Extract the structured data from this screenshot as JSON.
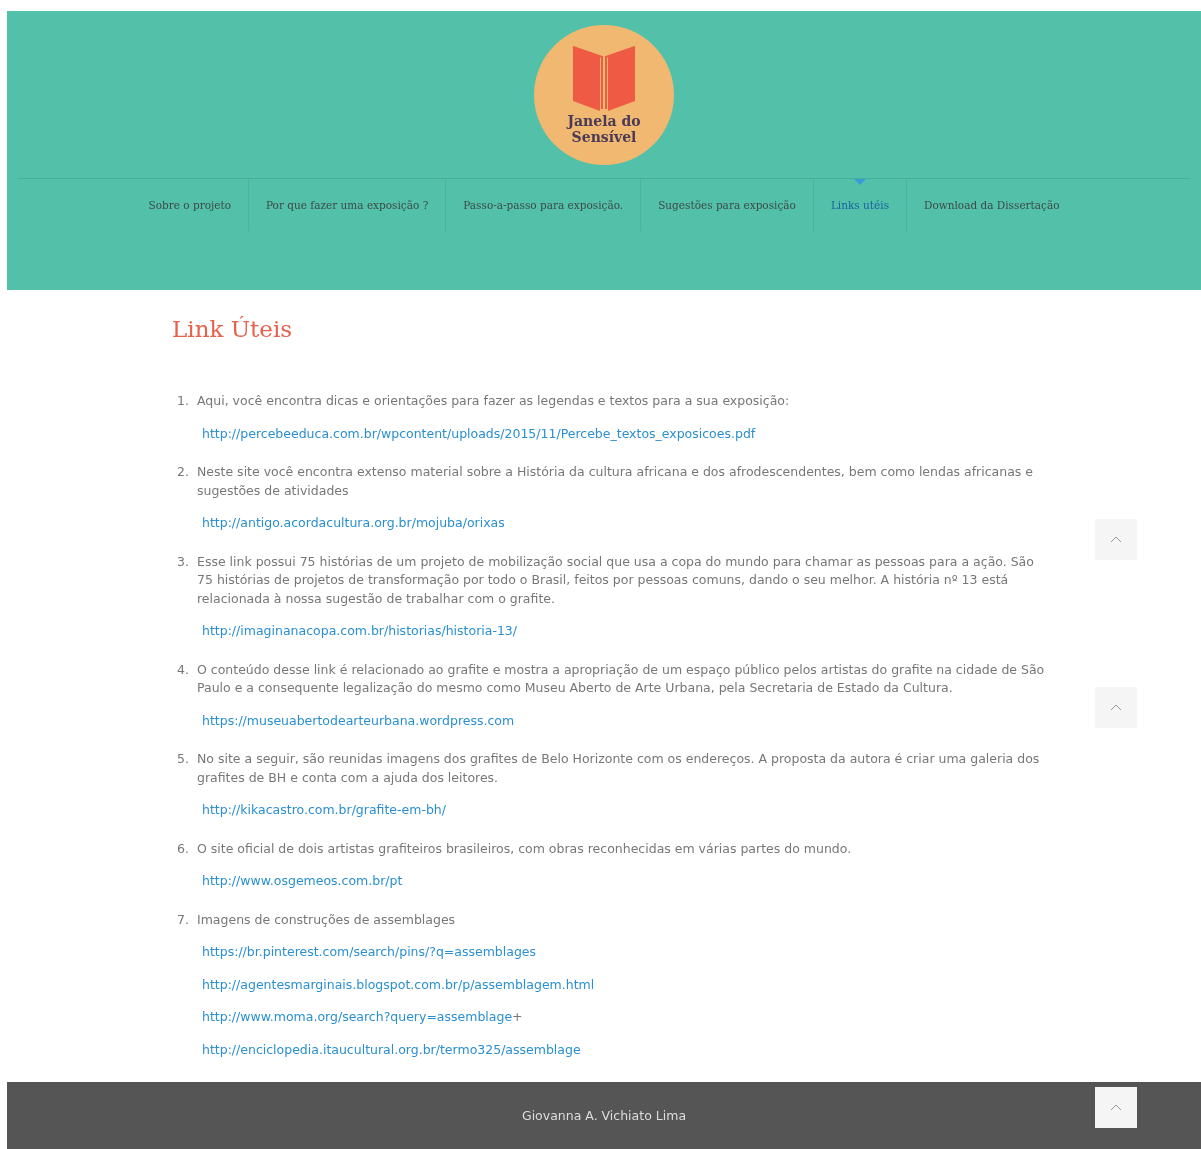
{
  "logo": {
    "text_line_1": "Janela do",
    "text_line_2": "Sensível"
  },
  "nav": [
    {
      "label": "Sobre o projeto",
      "selected": false
    },
    {
      "label": "Por que fazer uma exposição ?",
      "selected": false
    },
    {
      "label": "Passo-a-passo para exposição.",
      "selected": false
    },
    {
      "label": "Sugestões para exposição",
      "selected": false
    },
    {
      "label": "Links utéis",
      "selected": true
    },
    {
      "label": "Download da Dissertação",
      "selected": false
    }
  ],
  "page_title": "Link Úteis",
  "items": [
    {
      "number": "1.",
      "text": "Aqui, você encontra dicas e orientações para fazer as legendas e textos para a sua exposição:",
      "links": [
        {
          "url": "http://percebeeduca.com.br/wpcontent/uploads/2015/11/Percebe_textos_exposicoes.pdf"
        }
      ]
    },
    {
      "number": "2.",
      "text": "Neste site você encontra extenso material sobre a História da cultura africana e dos afrodescendentes, bem como lendas africanas e sugestões de atividades",
      "links": [
        {
          "url": "http://antigo.acordacultura.org.br/mojuba/orixas"
        }
      ]
    },
    {
      "number": "3.",
      "text": "Esse link possui 75 histórias de um projeto de mobilização social que usa a copa do mundo para chamar as pessoas para a ação. São 75 histórias de projetos de transformação por todo o Brasil, feitos por pessoas comuns, dando o seu melhor. A história nº 13 está relacionada à nossa sugestão de trabalhar com o grafite.",
      "links": [
        {
          "url": "http://imaginanacopa.com.br/historias/historia-13/"
        }
      ]
    },
    {
      "number": "4.",
      "text": "O conteúdo desse link é relacionado ao grafite e mostra a apropriação de um espaço público pelos artistas do grafite na cidade de São Paulo e a consequente legalização do mesmo como Museu Aberto de Arte Urbana, pela Secretaria de Estado da Cultura.",
      "links": [
        {
          "url": "https://museuabertodearteurbana.wordpress.com"
        }
      ]
    },
    {
      "number": "5.",
      "text": "No site a seguir, são reunidas imagens dos grafites de Belo Horizonte com os endereços. A proposta da autora é criar uma galeria  dos grafites de BH e conta com a ajuda dos leitores.",
      "links": [
        {
          "url": "http://kikacastro.com.br/grafite-em-bh/"
        }
      ]
    },
    {
      "number": "6.",
      "text": "O site oficial de dois artistas grafiteiros brasileiros, com obras reconhecidas em várias partes do mundo.",
      "links": [
        {
          "url": "http://www.osgemeos.com.br/pt"
        }
      ]
    },
    {
      "number": "7.",
      "text": "Imagens de construções de assemblages",
      "links": [
        {
          "url": "https://br.pinterest.com/search/pins/?q=assemblages"
        },
        {
          "url": "http://agentesmarginais.blogspot.com.br/p/assemblagem.html"
        },
        {
          "url": "http://www.moma.org/search?query=assemblage",
          "trailing": "+"
        },
        {
          "url": "http://enciclopedia.itaucultural.org.br/termo325/assemblage"
        }
      ]
    }
  ],
  "footer": {
    "credit": "Giovanna A. Vichiato Lima"
  }
}
